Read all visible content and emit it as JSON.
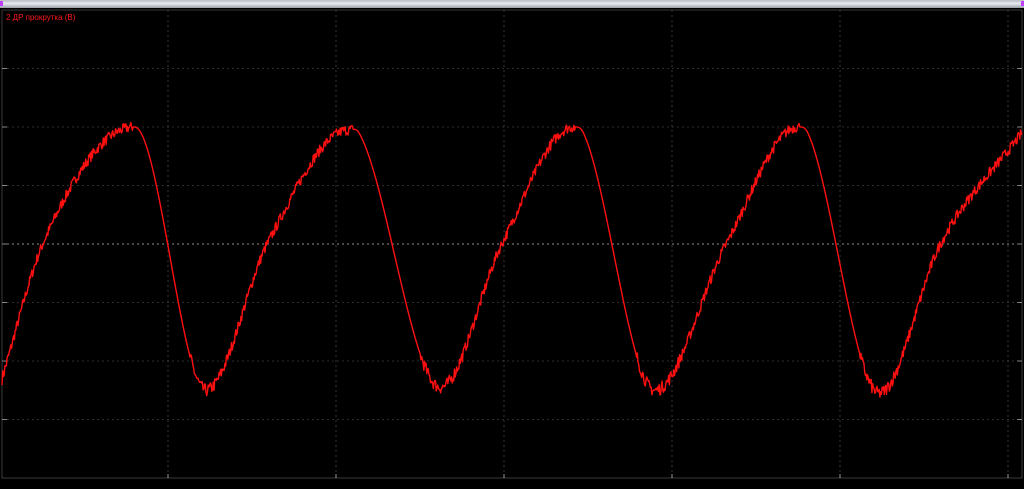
{
  "window": {
    "title": ""
  },
  "legend": {
    "series_label": "2 ДР прокрутка (В)"
  },
  "colors": {
    "background": "#000000",
    "series": "#ff1010",
    "grid": "#5a5a5a",
    "zero_line": "#bdbdbd"
  },
  "chart_data": {
    "type": "line",
    "title": "",
    "xlabel": "",
    "ylabel": "",
    "x_tick_labels": [
      "",
      "",
      "",
      "",
      "",
      ""
    ],
    "xlim": [
      0,
      1
    ],
    "ylim": [
      -4,
      4
    ],
    "grid": true,
    "legend_position": "top-left",
    "series": [
      {
        "name": "2 ДР прокрутка (В)",
        "x": [
          0,
          0.04,
          0.13,
          0.2,
          0.26,
          0.34,
          0.35,
          0.43,
          0.49,
          0.56,
          0.57,
          0.64,
          0.71,
          0.78,
          0.79,
          0.86,
          0.92,
          1.0
        ],
        "y": [
          -2.3,
          0.0,
          2.0,
          -2.5,
          0.0,
          1.95,
          1.9,
          -2.45,
          0.0,
          2.0,
          1.9,
          -2.5,
          0.0,
          2.0,
          1.9,
          -2.55,
          0.0,
          1.9
        ]
      }
    ]
  }
}
